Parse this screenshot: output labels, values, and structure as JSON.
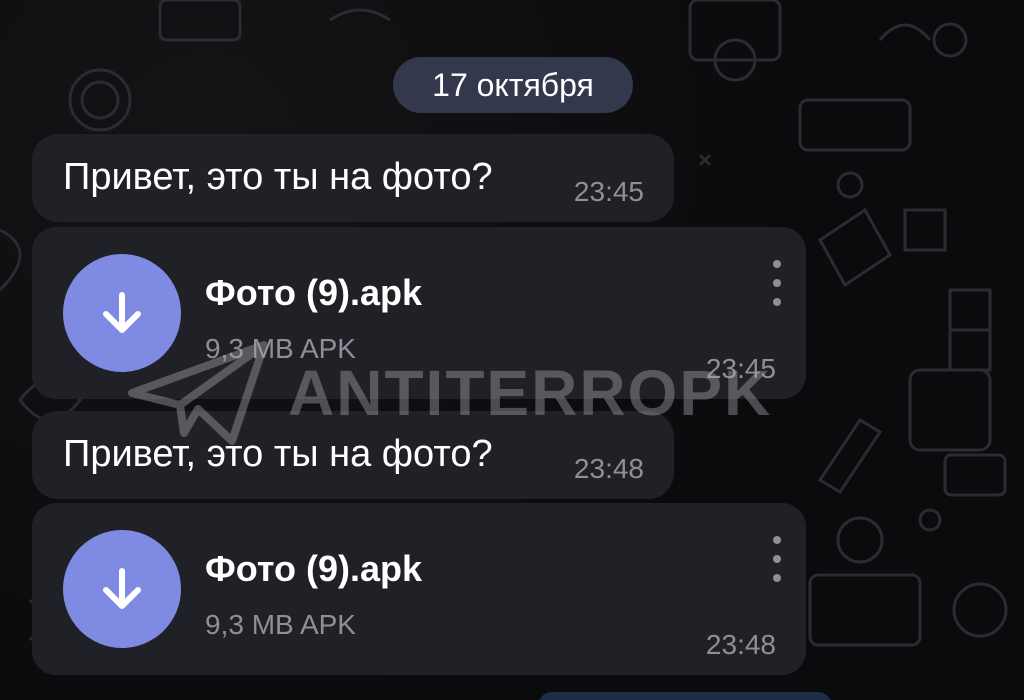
{
  "chat": {
    "date_separator": "17 октября",
    "messages": [
      {
        "type": "text",
        "text": "Привет, это ты на фото?",
        "time": "23:45"
      },
      {
        "type": "file",
        "file_name": "Фото (9).apk",
        "file_meta": "9,3 MB APK",
        "time": "23:45",
        "icon": "download-arrow-icon"
      },
      {
        "type": "text",
        "text": "Привет, это ты на фото?",
        "time": "23:48"
      },
      {
        "type": "file",
        "file_name": "Фото (9).apk",
        "file_meta": "9,3 MB APK",
        "time": "23:48",
        "icon": "download-arrow-icon"
      }
    ]
  },
  "watermark": {
    "text": "ANTITERROPK"
  },
  "colors": {
    "background": "#0b0b0d",
    "bubble": "#202127",
    "date_chip": "#33384c",
    "download_icon": "#7f8ae3",
    "secondary_text": "#8e8f97"
  }
}
